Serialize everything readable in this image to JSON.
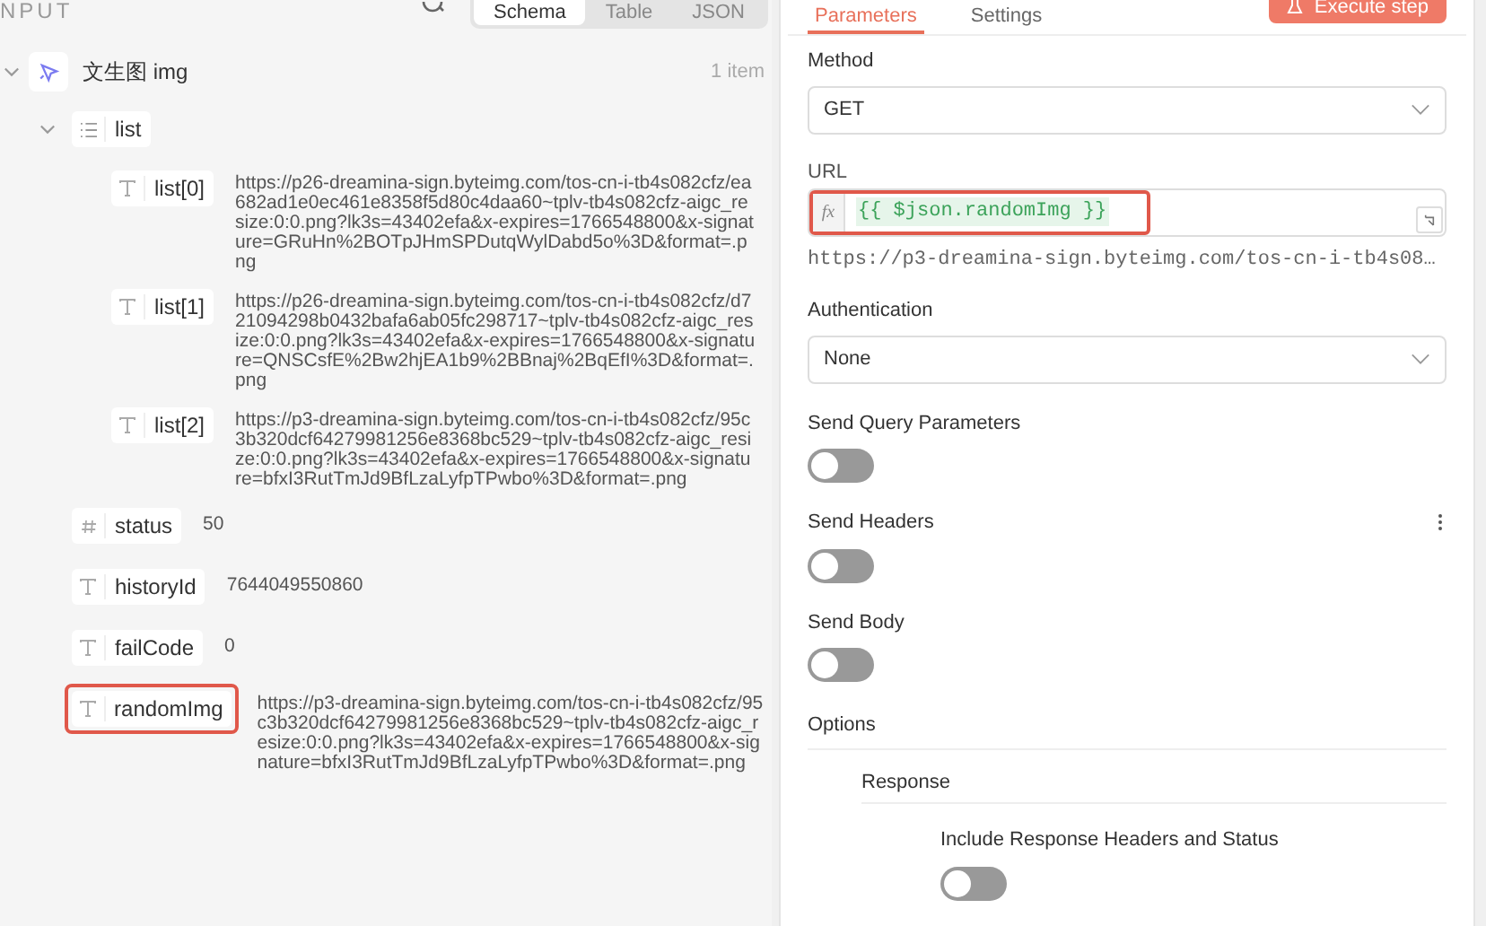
{
  "input_panel": {
    "title": "NPUT",
    "view_tabs": [
      {
        "label": "Schema",
        "selected": true
      },
      {
        "label": "Table",
        "selected": false
      },
      {
        "label": "JSON",
        "selected": false
      }
    ],
    "tree": [
      {
        "kind": "node",
        "label": "文生图 img",
        "count": "1 item",
        "expanded": true,
        "children": [
          {
            "kind": "array",
            "label": "list",
            "expanded": true,
            "children": [
              {
                "kind": "string",
                "label": "list[0]",
                "value": "https://p26-dreamina-sign.byteimg.com/tos-cn-i-tb4s082cfz/ea682ad1e0ec461e8358f5d80c4daa60~tplv-tb4s082cfz-aigc_resize:0:0.png?lk3s=43402efa&x-expires=1766548800&x-signature=GRuHn%2BOTpJHmSPDutqWylDabd5o%3D&format=.png",
                "highlighted": false
              },
              {
                "kind": "string",
                "label": "list[1]",
                "value": "https://p26-dreamina-sign.byteimg.com/tos-cn-i-tb4s082cfz/d721094298b0432bafa6ab05fc298717~tplv-tb4s082cfz-aigc_resize:0:0.png?lk3s=43402efa&x-expires=1766548800&x-signature=QNSCsfE%2Bw2hjEA1b9%2BBnaj%2BqEfI%3D&format=.png",
                "highlighted": false
              },
              {
                "kind": "string",
                "label": "list[2]",
                "value": "https://p3-dreamina-sign.byteimg.com/tos-cn-i-tb4s082cfz/95c3b320dcf64279981256e8368bc529~tplv-tb4s082cfz-aigc_resize:0:0.png?lk3s=43402efa&x-expires=1766548800&x-signature=bfxI3RutTmJd9BfLzaLyfpTPwbo%3D&format=.png",
                "highlighted": false
              }
            ]
          },
          {
            "kind": "number",
            "label": "status",
            "value": "50",
            "highlighted": false
          },
          {
            "kind": "string",
            "label": "historyId",
            "value": "7644049550860",
            "highlighted": false
          },
          {
            "kind": "string",
            "label": "failCode",
            "value": "0",
            "highlighted": false
          },
          {
            "kind": "string",
            "label": "randomImg",
            "value": "https://p3-dreamina-sign.byteimg.com/tos-cn-i-tb4s082cfz/95c3b320dcf64279981256e8368bc529~tplv-tb4s082cfz-aigc_resize:0:0.png?lk3s=43402efa&x-expires=1766548800&x-signature=bfxI3RutTmJd9BfLzaLyfpTPwbo%3D&format=.png",
            "highlighted": true
          }
        ]
      }
    ]
  },
  "parameters_panel": {
    "tabs": [
      {
        "label": "Parameters",
        "selected": true
      },
      {
        "label": "Settings",
        "selected": false
      }
    ],
    "execute_button": "Execute step",
    "method": {
      "label": "Method",
      "value": "GET"
    },
    "url": {
      "label": "URL",
      "prefix": "fx",
      "expression": "{{ $json.randomImg }}",
      "preview": "https://p3-dreamina-sign.byteimg.com/tos-cn-i-tb4s08…",
      "highlighted": true
    },
    "authentication": {
      "label": "Authentication",
      "value": "None"
    },
    "toggles": [
      {
        "label": "Send Query Parameters",
        "on": false,
        "menu": false
      },
      {
        "label": "Send Headers",
        "on": false,
        "menu": true
      },
      {
        "label": "Send Body",
        "on": false,
        "menu": false
      }
    ],
    "options": {
      "title": "Options",
      "groups": [
        {
          "title": "Response",
          "toggles": [
            {
              "label": "Include Response Headers and Status",
              "on": false
            }
          ]
        }
      ]
    }
  }
}
